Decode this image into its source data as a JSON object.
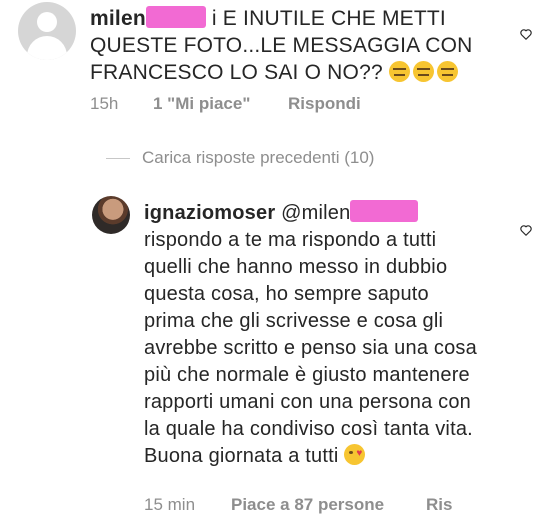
{
  "comment": {
    "username_visible": "milen",
    "text_line1": "i E INUTILE CHE METTI",
    "text_rest": "QUESTE FOTO...LE MESSAGGIA CON FRANCESCO LO SAI O NO??",
    "time": "15h",
    "likes": "1 \"Mi piace\"",
    "reply_label": "Rispondi",
    "emoji": "expressionless-emoji"
  },
  "load_previous": "Carica risposte precedenti (10)",
  "reply": {
    "username": "ignaziomoser",
    "mention_visible": "@milen",
    "text": "rispondo a te ma rispondo a tutti quelli che hanno messo in dubbio questa cosa, ho sempre saputo prima che gli scrivesse e cosa gli avrebbe scritto e penso sia una cosa più che normale è giusto mantenere rapporti umani con una persona con la quale ha condiviso così tanta vita. Buona giornata a tutti",
    "emoji": "kissing-heart-emoji",
    "time": "15 min",
    "likes": "Piace a 87 persone",
    "reply_label": "Ris"
  },
  "colors": {
    "text": "#262626",
    "meta": "#8e8e8e",
    "redaction": "#f26ad3",
    "emoji": "#f7c531"
  }
}
